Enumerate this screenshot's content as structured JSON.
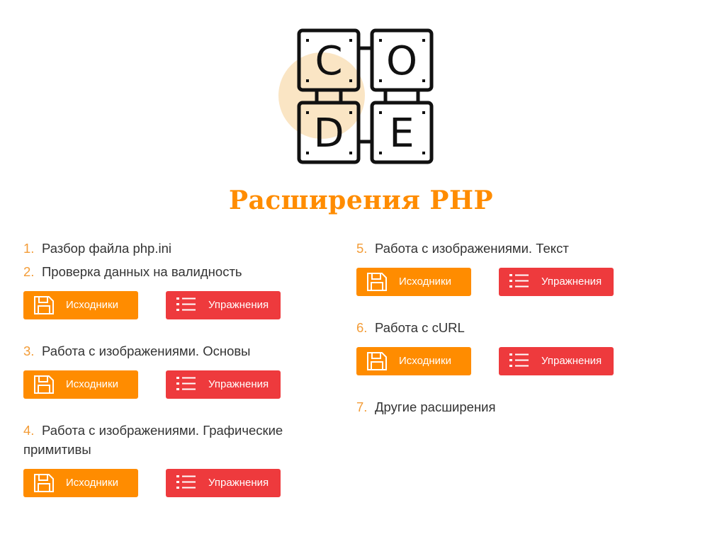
{
  "logo": {
    "letters": [
      "C",
      "O",
      "D",
      "E"
    ],
    "icon": "code-blocks-logo"
  },
  "page": {
    "title": "Расширения PHP"
  },
  "buttons": {
    "sources_label": "Исходники",
    "exercises_label": "Упражнения",
    "sources_icon": "floppy-disk-icon",
    "exercises_icon": "list-icon"
  },
  "items": [
    {
      "num": "1.",
      "label": "Разбор файла php.ini"
    },
    {
      "num": "2.",
      "label": "Проверка данных на валидность"
    },
    {
      "num": "3.",
      "label": "Работа с изображениями. Основы"
    },
    {
      "num": "4.",
      "label": "Работа с изображениями. Графические примитивы"
    },
    {
      "num": "5.",
      "label": "Работа с изображениями. Текст"
    },
    {
      "num": "6.",
      "label": "Работа с cURL"
    },
    {
      "num": "7.",
      "label": "Другие расширения"
    }
  ],
  "colors": {
    "accent": "#ff8c00",
    "red": "#ee3a3d",
    "number": "#f39c37",
    "circle": "#fae5c4"
  }
}
